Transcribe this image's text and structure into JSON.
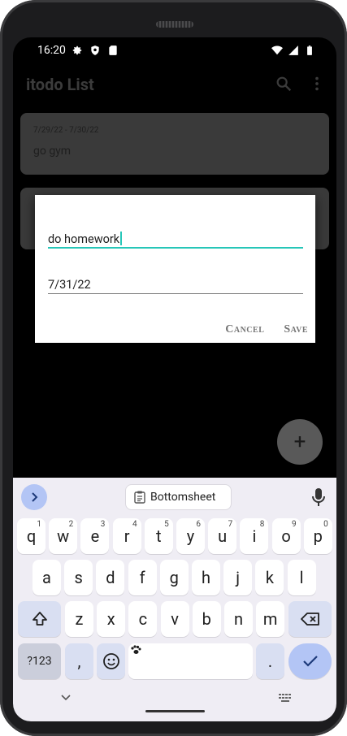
{
  "status_bar": {
    "time": "16:20"
  },
  "app_bar": {
    "title": "itodo List"
  },
  "todos": [
    {
      "date_range": "7/29/22  -  7/30/22",
      "title": "go gym"
    },
    {
      "date_range": "",
      "title": ""
    }
  ],
  "dialog": {
    "title_field_value": "do homework",
    "date_field_value": "7/31/22",
    "cancel_label": "Cancel",
    "save_label": "Save"
  },
  "fab": {
    "label": "+"
  },
  "keyboard": {
    "clipboard_chip": "Bottomsheet",
    "row1": [
      {
        "k": "q",
        "h": "1"
      },
      {
        "k": "w",
        "h": "2"
      },
      {
        "k": "e",
        "h": "3"
      },
      {
        "k": "r",
        "h": "4"
      },
      {
        "k": "t",
        "h": "5"
      },
      {
        "k": "y",
        "h": "6"
      },
      {
        "k": "u",
        "h": "7"
      },
      {
        "k": "i",
        "h": "8"
      },
      {
        "k": "o",
        "h": "9"
      },
      {
        "k": "p",
        "h": "0"
      }
    ],
    "row2": [
      "a",
      "s",
      "d",
      "f",
      "g",
      "h",
      "j",
      "k",
      "l"
    ],
    "row3": [
      "z",
      "x",
      "c",
      "v",
      "b",
      "n",
      "m"
    ],
    "symbols_label": "?123",
    "comma_label": ",",
    "period_label": "."
  },
  "colors": {
    "accent": "#26c6b8",
    "keyboard_accent": "#b3c5f5",
    "background": "#000000"
  }
}
